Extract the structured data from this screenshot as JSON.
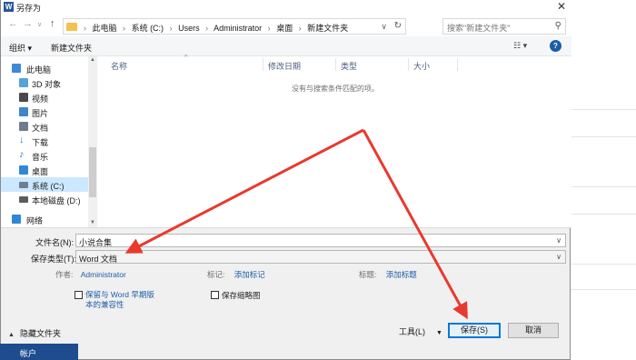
{
  "window": {
    "title": "另存为",
    "app_icon": "W"
  },
  "nav": {
    "crumbs": [
      "此电脑",
      "系统 (C:)",
      "Users",
      "Administrator",
      "桌面",
      "新建文件夹"
    ],
    "search_placeholder": "搜索\"新建文件夹\""
  },
  "toolbar": {
    "organize": "组织 ▾",
    "new_folder": "新建文件夹"
  },
  "sidebar": {
    "items": [
      {
        "label": "此电脑",
        "icon": "pc-icon",
        "color": "#3b8ad9"
      },
      {
        "label": "3D 对象",
        "icon": "cube-icon",
        "color": "#56a3d8"
      },
      {
        "label": "视频",
        "icon": "video-icon",
        "color": "#4a4a4a"
      },
      {
        "label": "图片",
        "icon": "picture-icon",
        "color": "#3f86c8"
      },
      {
        "label": "文档",
        "icon": "document-icon",
        "color": "#6d7d8e"
      },
      {
        "label": "下载",
        "icon": "download-icon",
        "color": "#2b7bd3"
      },
      {
        "label": "音乐",
        "icon": "music-icon",
        "color": "#2b7bd3"
      },
      {
        "label": "桌面",
        "icon": "desktop-icon",
        "color": "#2f88d6"
      },
      {
        "label": "系统 (C:)",
        "icon": "drive-icon",
        "color": "#6e7f92"
      },
      {
        "label": "本地磁盘 (D:)",
        "icon": "drive-icon",
        "color": "#5c5c5c"
      },
      {
        "label": "网络",
        "icon": "network-icon",
        "color": "#2f88d6"
      }
    ]
  },
  "filelist": {
    "columns": [
      "名称",
      "修改日期",
      "类型",
      "大小"
    ],
    "empty_message": "没有与搜索条件匹配的项。"
  },
  "form": {
    "filename_label": "文件名(N):",
    "filename_value": "小说合集",
    "type_label": "保存类型(T):",
    "type_value": "Word 文档",
    "author_label": "作者:",
    "author_value": "Administrator",
    "tags_label": "标记:",
    "tags_value": "添加标记",
    "title_label": "标题:",
    "title_value": "添加标题",
    "compat_line1": "保留与 Word 早期版",
    "compat_line2": "本的兼容性",
    "thumb_label": "保存缩略图"
  },
  "footer": {
    "hide_folders": "隐藏文件夹",
    "tools": "工具(L)",
    "save": "保存(S)",
    "cancel": "取消"
  },
  "background": {
    "account": "帐户"
  },
  "colors": {
    "accent": "#0078d7",
    "link": "#1f5ea6",
    "arrow": "#e8392f"
  }
}
